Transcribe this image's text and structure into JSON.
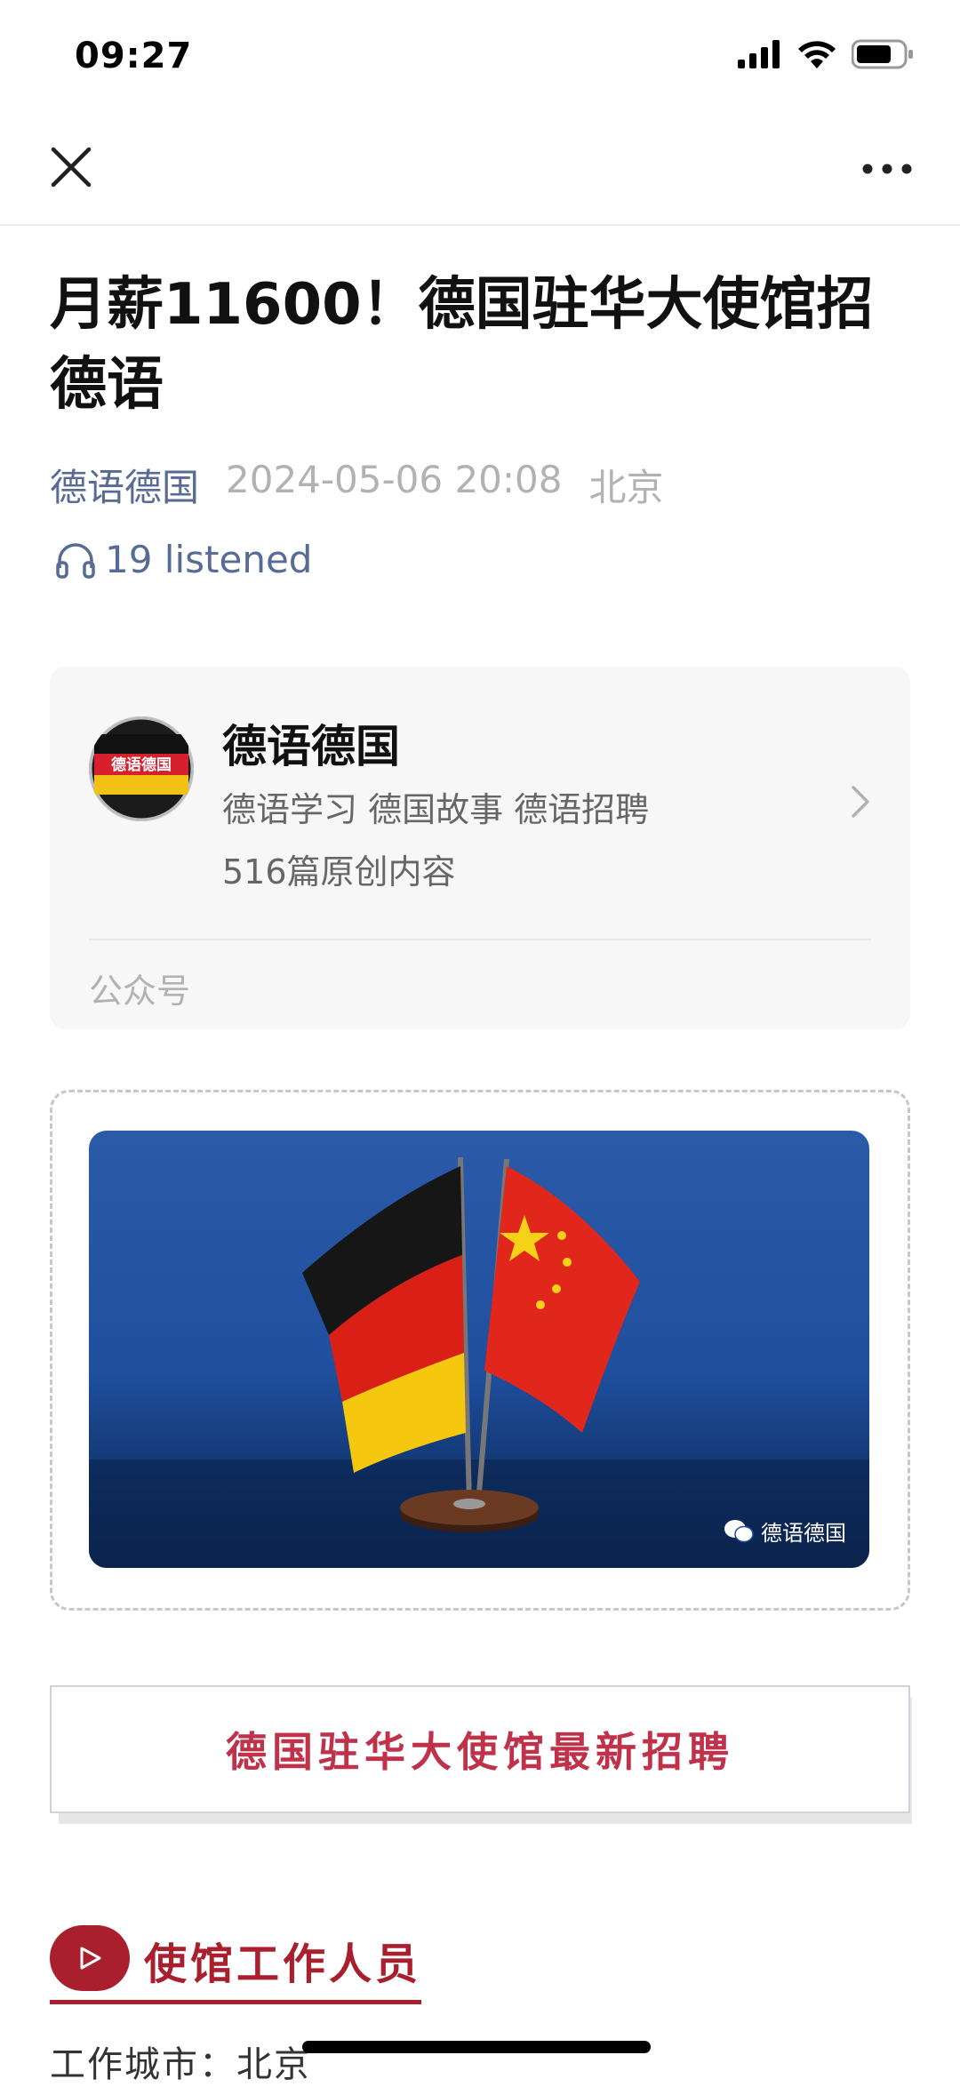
{
  "status_bar": {
    "time": "09:27",
    "icons": [
      "cellular-signal-icon",
      "wifi-icon",
      "battery-icon"
    ]
  },
  "nav": {
    "close_icon": "close-icon",
    "more_icon": "more-icon"
  },
  "article": {
    "title": "月薪11600！德国驻华大使馆招德语",
    "account": "德语德国",
    "date": "2024-05-06 20:08",
    "location": "北京",
    "listen_count": "19 listened"
  },
  "profile_card": {
    "avatar_text": "德语德国",
    "name": "德语德国",
    "description": "德语学习 德国故事 德语招聘",
    "original_count": "516篇原创内容",
    "type": "公众号"
  },
  "cover": {
    "watermark": "德语德国"
  },
  "banner": {
    "text": "德国驻华大使馆最新招聘"
  },
  "section": {
    "title": "使馆工作人员"
  },
  "body": {
    "line1": "工作城市：北京"
  },
  "colors": {
    "link": "#576b95",
    "meta_gray": "#b2b2b2",
    "accent_red": "#a91f2d",
    "banner_red": "#c0314a"
  }
}
